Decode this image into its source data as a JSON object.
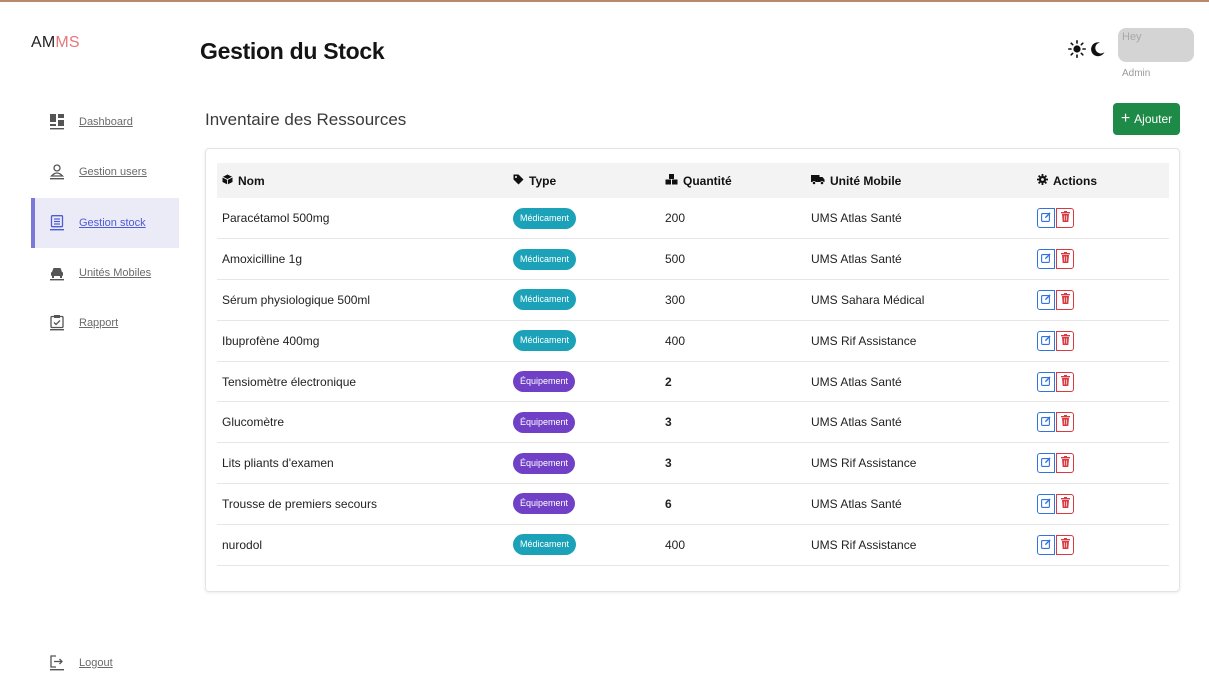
{
  "brand": {
    "part1": "AM",
    "part2": "MS"
  },
  "sidebar": {
    "items": [
      {
        "label": "Dashboard",
        "icon": "dashboard-icon"
      },
      {
        "label": "Gestion users",
        "icon": "user-icon"
      },
      {
        "label": "Gestion stock",
        "icon": "inventory-icon",
        "active": true
      },
      {
        "label": "Unités Mobiles",
        "icon": "car-icon"
      },
      {
        "label": "Rapport",
        "icon": "clipboard-icon"
      }
    ],
    "logout": "Logout"
  },
  "header": {
    "title": "Gestion du Stock",
    "user_greeting": "Hey",
    "user_role": "Admin"
  },
  "section": {
    "title": "Inventaire des Ressources",
    "add_label": "Ajouter"
  },
  "table": {
    "headers": {
      "nom": "Nom",
      "type": "Type",
      "quantite": "Quantité",
      "unite": "Unité Mobile",
      "actions": "Actions"
    },
    "rows": [
      {
        "nom": "Paracétamol 500mg",
        "type": "Médicament",
        "quantite": "200",
        "unite": "UMS Atlas Santé"
      },
      {
        "nom": "Amoxicilline 1g",
        "type": "Médicament",
        "quantite": "500",
        "unite": "UMS Atlas Santé"
      },
      {
        "nom": "Sérum physiologique 500ml",
        "type": "Médicament",
        "quantite": "300",
        "unite": "UMS Sahara Médical"
      },
      {
        "nom": "Ibuprofène 400mg",
        "type": "Médicament",
        "quantite": "400",
        "unite": "UMS Rif Assistance"
      },
      {
        "nom": "Tensiomètre électronique",
        "type": "Équipement",
        "quantite": "2",
        "unite": "UMS Atlas Santé"
      },
      {
        "nom": "Glucomètre",
        "type": "Équipement",
        "quantite": "3",
        "unite": "UMS Atlas Santé"
      },
      {
        "nom": "Lits pliants d'examen",
        "type": "Équipement",
        "quantite": "3",
        "unite": "UMS Rif Assistance"
      },
      {
        "nom": "Trousse de premiers secours",
        "type": "Équipement",
        "quantite": "6",
        "unite": "UMS Atlas Santé"
      },
      {
        "nom": "nurodol",
        "type": "Médicament",
        "quantite": "400",
        "unite": "UMS Rif Assistance"
      }
    ]
  },
  "colors": {
    "accent": "#7a79d8",
    "medicament_badge": "#1ba2b8",
    "equipement_badge": "#7040c6",
    "add_button": "#1e8a47",
    "edit": "#2f74e0",
    "delete": "#d9393f",
    "brand_highlight": "#e8767a"
  }
}
